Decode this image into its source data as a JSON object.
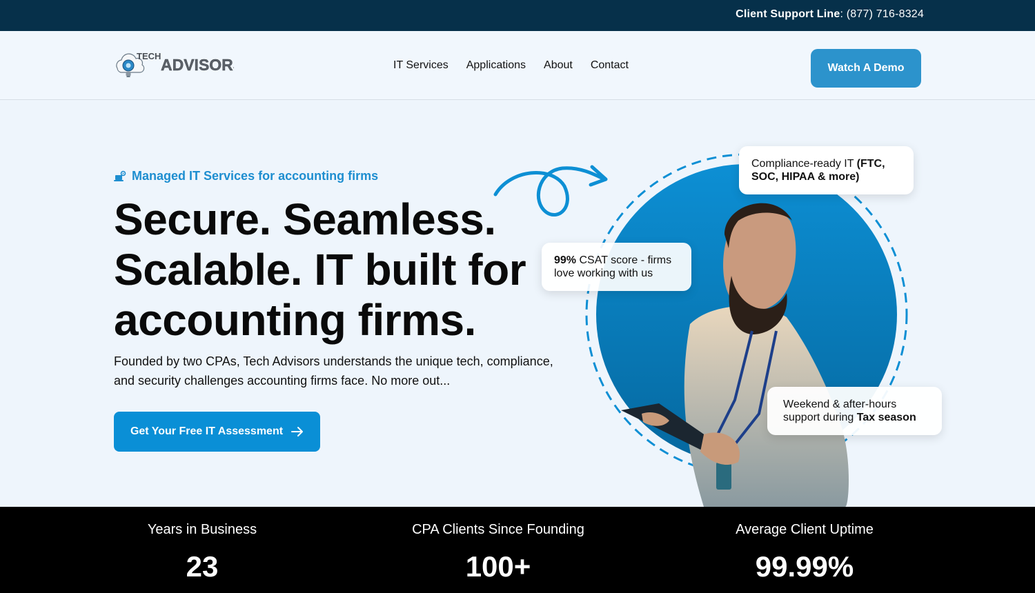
{
  "topbar": {
    "support_label": "Client Support Line",
    "support_sep": ":",
    "support_phone": "(877) 716-8324"
  },
  "brand": {
    "logo_text_1": "TECH",
    "logo_text_2": "ADVISORS"
  },
  "nav": {
    "items": [
      "IT Services",
      "Applications",
      "About",
      "Contact"
    ]
  },
  "header": {
    "demo_label": "Watch A Demo"
  },
  "hero": {
    "tagline": "Managed IT Services for accounting firms",
    "headline_1": "Secure. Seamless.",
    "headline_2": "Scalable. IT built for",
    "headline_3": "accounting firms.",
    "description": "Founded by two CPAs, Tech Advisors understands the unique tech, compliance, and security challenges accounting firms face. No more out...",
    "cta_label": "Get Your Free IT Assessment"
  },
  "cards": {
    "compliance_prefix": "Compliance-ready IT",
    "compliance_bold": "(FTC, SOC, HIPAA & more)",
    "csat_bold": "99%",
    "csat_text": "CSAT score - firms love working with us",
    "weekend_text": "Weekend & after-hours support during",
    "weekend_bold": "Tax season"
  },
  "stats": [
    {
      "label": "Years in Business",
      "value": "23"
    },
    {
      "label": "CPA Clients Since Founding",
      "value": "100+"
    },
    {
      "label": "Average Client Uptime",
      "value": "99.99%"
    }
  ],
  "colors": {
    "topbar": "#06304a",
    "accent": "#0a8fd6",
    "demo_button": "#2c93cc",
    "hero_bg": "#eef5fc",
    "stats_bg": "#000000"
  },
  "icons": {
    "tagline": "laptop-gear-icon",
    "cta": "arrow-right-icon",
    "decoration": "curly-arrow-icon"
  }
}
